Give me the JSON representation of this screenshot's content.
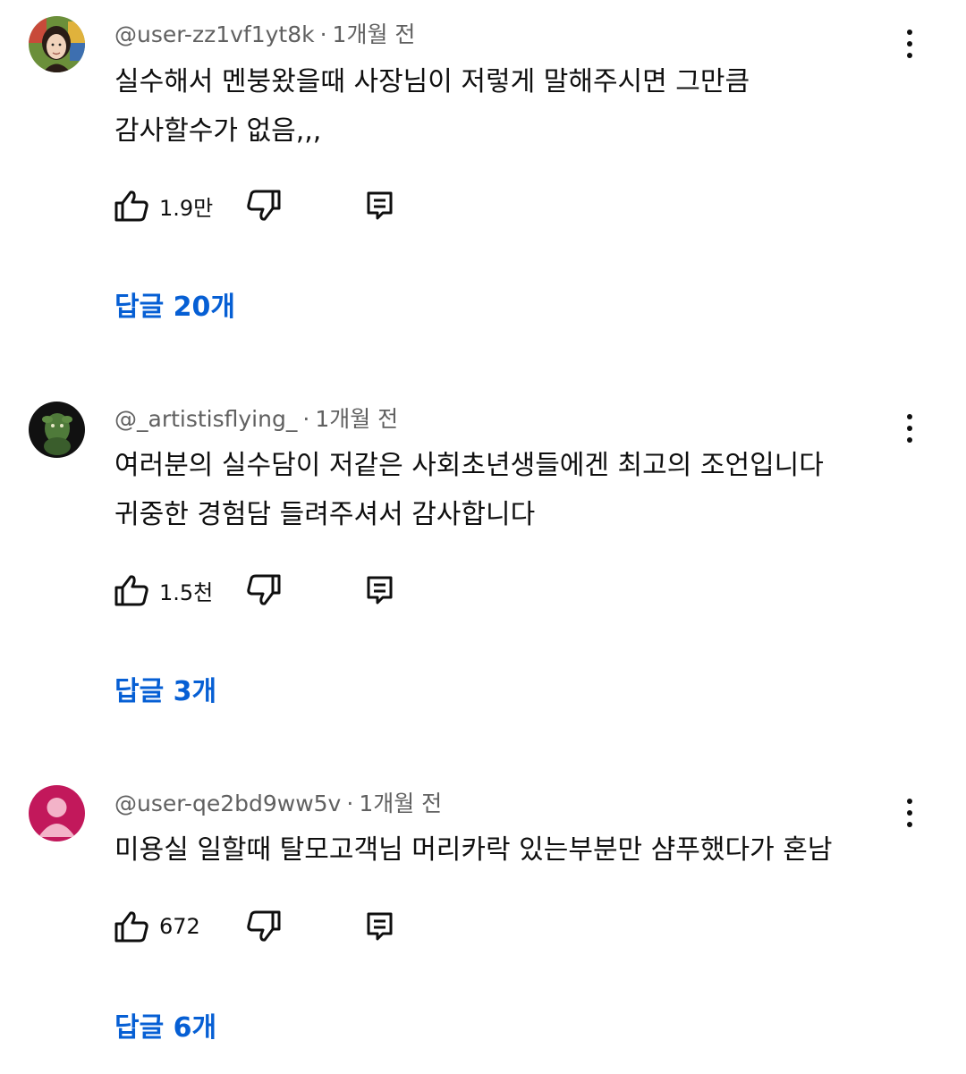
{
  "comments": [
    {
      "author": "@user-zz1vf1yt8k",
      "time": "1개월 전",
      "lines": [
        "실수해서 멘붕왔을때 사장님이 저렇게 말해주시면 그만큼",
        "감사할수가 없음,,,"
      ],
      "likes": "1.9만",
      "replies": "답글 20개"
    },
    {
      "author": "@_artistisflying_",
      "time": "1개월 전",
      "lines": [
        "여러분의 실수담이 저같은 사회초년생들에겐 최고의 조언입니다",
        "귀중한 경험담 들려주셔서 감사합니다"
      ],
      "likes": "1.5천",
      "replies": "답글 3개"
    },
    {
      "author": "@user-qe2bd9ww5v",
      "time": "1개월 전",
      "lines": [
        "미용실 일할때 탈모고객님 머리카락 있는부분만 샴푸했다가 혼남"
      ],
      "likes": "672",
      "replies": "답글 6개"
    }
  ],
  "meta_separator": "·",
  "colors": {
    "reply_link": "#065fd4",
    "meta_text": "#606060",
    "default_avatar_bg": "#c2185b"
  },
  "icons": {
    "like": "thumbs-up-icon",
    "dislike": "thumbs-down-icon",
    "reply": "reply-comment-icon",
    "more": "more-vertical-icon"
  }
}
